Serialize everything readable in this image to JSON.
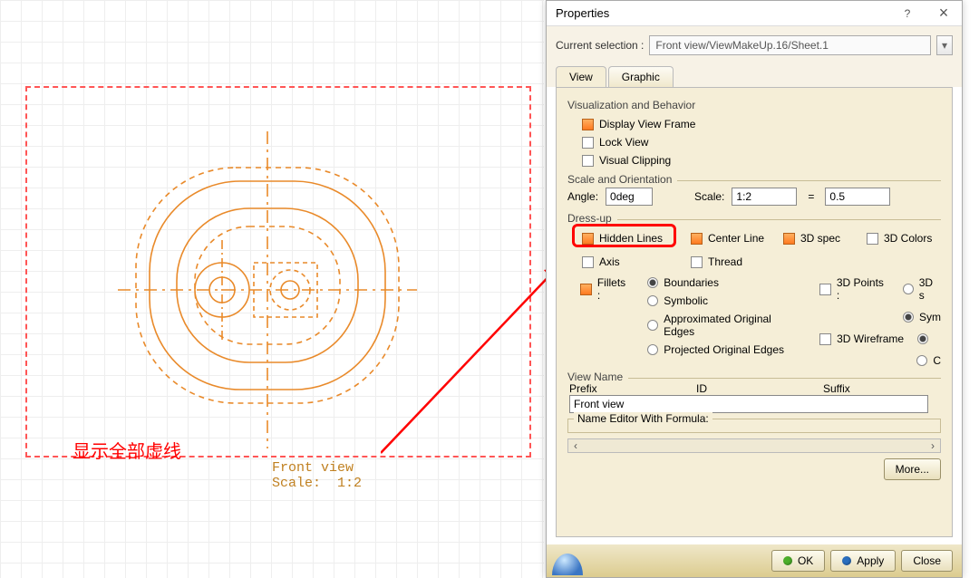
{
  "canvas": {
    "drawing_label_line1": "Front view",
    "drawing_label_line2": "Scale:  1:2",
    "cn_annotation": "显示全部虚线"
  },
  "dialog": {
    "title": "Properties",
    "help_glyph": "?",
    "close_glyph": "×",
    "current_selection_label": "Current selection :",
    "current_selection_value": "Front view/ViewMakeUp.16/Sheet.1",
    "tabs": {
      "view": "View",
      "graphic": "Graphic"
    },
    "visualization": {
      "legend": "Visualization and Behavior",
      "display_view_frame": "Display View Frame",
      "lock_view": "Lock View",
      "visual_clipping": "Visual Clipping"
    },
    "scale_orientation": {
      "legend": "Scale and Orientation",
      "angle_label": "Angle:",
      "angle_value": "0deg",
      "scale_label": "Scale:",
      "scale_value": "1:2",
      "equals": "=",
      "ratio_value": "0.5"
    },
    "dressup": {
      "legend": "Dress-up",
      "hidden_lines": "Hidden Lines",
      "center_line": "Center Line",
      "spec3d": "3D spec",
      "colors3d": "3D Colors",
      "axis": "Axis",
      "thread": "Thread",
      "fillets": "Fillets :",
      "boundaries": "Boundaries",
      "symbolic": "Symbolic",
      "approx": "Approximated Original Edges",
      "projected": "Projected Original Edges",
      "points3d": "3D Points :",
      "d3d": "3D s",
      "sym": "Sym",
      "wire3d": "3D Wireframe",
      "c": "C"
    },
    "view_name": {
      "legend": "View Name",
      "prefix": "Prefix",
      "id": "ID",
      "suffix": "Suffix",
      "prefix_value": "Front view",
      "name_editor_legend": "Name Editor With Formula:"
    },
    "buttons": {
      "more": "More...",
      "ok": "OK",
      "apply": "Apply",
      "close": "Close"
    },
    "scrollbar": {
      "left": "‹",
      "right": "›"
    }
  }
}
